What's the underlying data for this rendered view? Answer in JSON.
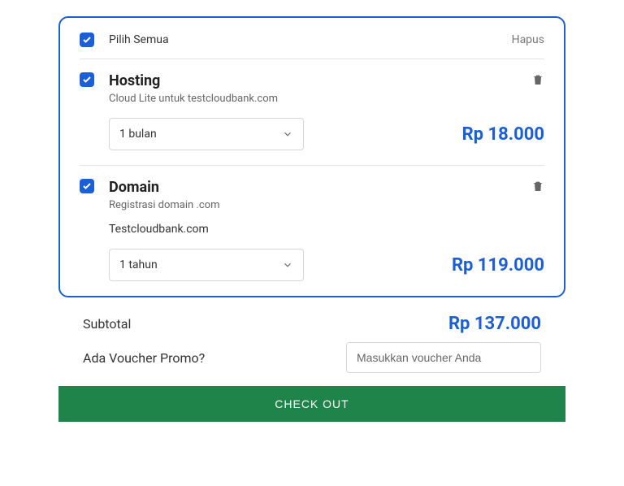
{
  "header": {
    "selectAll": "Pilih Semua",
    "delete": "Hapus"
  },
  "items": [
    {
      "title": "Hosting",
      "subtitle": "Cloud Lite untuk testcloudbank.com",
      "extra": "",
      "duration": "1 bulan",
      "price": "Rp 18.000"
    },
    {
      "title": "Domain",
      "subtitle": "Registrasi domain .com",
      "extra": "Testcloudbank.com",
      "duration": "1 tahun",
      "price": "Rp 119.000"
    }
  ],
  "summary": {
    "subtotalLabel": "Subtotal",
    "subtotalValue": "Rp 137.000",
    "voucherLabel": "Ada Voucher Promo?",
    "voucherPlaceholder": "Masukkan voucher Anda"
  },
  "checkout": "CHECK OUT"
}
